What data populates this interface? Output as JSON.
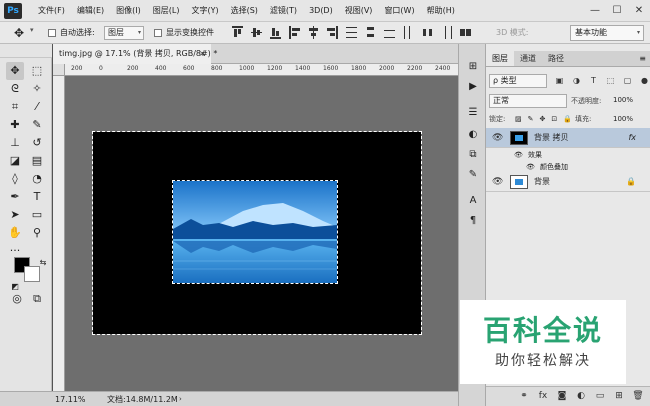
{
  "app": {
    "logo": "Ps"
  },
  "menu": [
    "文件(F)",
    "编辑(E)",
    "图像(I)",
    "图层(L)",
    "文字(Y)",
    "选择(S)",
    "滤镜(T)",
    "3D(D)",
    "视图(V)",
    "窗口(W)",
    "帮助(H)"
  ],
  "window_controls": {
    "minimize": "—",
    "maximize": "☐",
    "close": "✕"
  },
  "options": {
    "auto_select_label": "自动选择:",
    "auto_select_value": "图层",
    "show_transform_label": "显示变换控件",
    "mode_3d_label": "3D 模式:",
    "workspace": "基本功能"
  },
  "document": {
    "tab_title": "timg.jpg @ 17.1% (背景 拷贝, RGB/8#) *",
    "tab_close": "×",
    "ruler_ticks": [
      "200",
      "0",
      "200",
      "400",
      "600",
      "800",
      "1000",
      "1200",
      "1400",
      "1600",
      "1800",
      "2000",
      "2200",
      "2400"
    ],
    "zoom": "17.11%",
    "doc_info": "文档:14.8M/11.2M",
    "status_arrow": "›"
  },
  "layers_panel": {
    "tabs": [
      "图层",
      "通道",
      "路径"
    ],
    "menu_icon": "≡",
    "filter_kind": "ρ 类型",
    "blend_mode": "正常",
    "opacity_label": "不透明度:",
    "opacity_value": "100%",
    "lock_label": "锁定:",
    "fill_label": "填充:",
    "fill_value": "100%",
    "layers": [
      {
        "name": "背景 拷贝",
        "fx": "fx",
        "selected": true
      },
      {
        "name": "背景",
        "locked": true,
        "selected": false
      }
    ],
    "effects_label": "效果",
    "effect_name": "颜色叠加"
  },
  "watermark": {
    "title": "百科全说",
    "subtitle": "助你轻松解决"
  },
  "colors": {
    "accent": "#31a8ff",
    "watermark_green": "#29a372",
    "photo_blue": "#3aa0e8"
  }
}
